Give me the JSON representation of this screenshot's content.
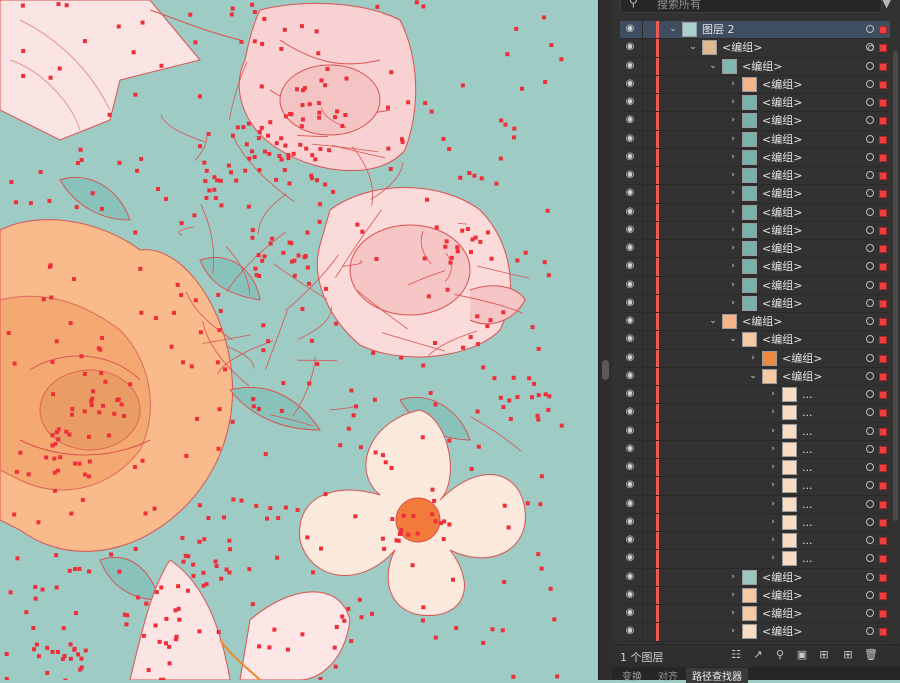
{
  "search": {
    "placeholder": "搜索所有"
  },
  "layers": [
    {
      "label": "图层 2",
      "depth": 0,
      "caret": "open",
      "thumb": "#a8d2cc",
      "selected": true,
      "target": "single"
    },
    {
      "label": "<编组>",
      "depth": 1,
      "caret": "open",
      "thumb": "#e0b890",
      "target": "double"
    },
    {
      "label": "<编组>",
      "depth": 2,
      "caret": "open",
      "thumb": "#7fb8b2",
      "target": "single"
    },
    {
      "label": "<编组>",
      "depth": 3,
      "caret": "closed",
      "thumb": "#f3b48a",
      "target": "single"
    },
    {
      "label": "<编组>",
      "depth": 3,
      "caret": "closed",
      "thumb": "#78b2ac",
      "target": "single"
    },
    {
      "label": "<编组>",
      "depth": 3,
      "caret": "closed",
      "thumb": "#78b2ac",
      "target": "single"
    },
    {
      "label": "<编组>",
      "depth": 3,
      "caret": "closed",
      "thumb": "#78b2ac",
      "target": "single"
    },
    {
      "label": "<编组>",
      "depth": 3,
      "caret": "closed",
      "thumb": "#78b2ac",
      "target": "single"
    },
    {
      "label": "<编组>",
      "depth": 3,
      "caret": "closed",
      "thumb": "#78b2ac",
      "target": "single"
    },
    {
      "label": "<编组>",
      "depth": 3,
      "caret": "closed",
      "thumb": "#78b2ac",
      "target": "single"
    },
    {
      "label": "<编组>",
      "depth": 3,
      "caret": "closed",
      "thumb": "#78b2ac",
      "target": "single"
    },
    {
      "label": "<编组>",
      "depth": 3,
      "caret": "closed",
      "thumb": "#78b2ac",
      "target": "single"
    },
    {
      "label": "<编组>",
      "depth": 3,
      "caret": "closed",
      "thumb": "#78b2ac",
      "target": "single"
    },
    {
      "label": "<编组>",
      "depth": 3,
      "caret": "closed",
      "thumb": "#78b2ac",
      "target": "single"
    },
    {
      "label": "<编组>",
      "depth": 3,
      "caret": "closed",
      "thumb": "#78b2ac",
      "target": "single"
    },
    {
      "label": "<编组>",
      "depth": 3,
      "caret": "closed",
      "thumb": "#78b2ac",
      "target": "single"
    },
    {
      "label": "<编组>",
      "depth": 2,
      "caret": "open",
      "thumb": "#f3b48a",
      "target": "single"
    },
    {
      "label": "<编组>",
      "depth": 3,
      "caret": "open",
      "thumb": "#f6c9a3",
      "target": "single"
    },
    {
      "label": "<编组>",
      "depth": 4,
      "caret": "closed",
      "thumb": "#ee8a3e",
      "target": "single"
    },
    {
      "label": "<编组>",
      "depth": 4,
      "caret": "open",
      "thumb": "#f6c9a3",
      "target": "single"
    },
    {
      "label": "...",
      "depth": 5,
      "caret": "closed",
      "thumb": "#f8dcc4",
      "target": "single"
    },
    {
      "label": "...",
      "depth": 5,
      "caret": "closed",
      "thumb": "#f8dcc4",
      "target": "single"
    },
    {
      "label": "...",
      "depth": 5,
      "caret": "closed",
      "thumb": "#f8dcc4",
      "target": "single"
    },
    {
      "label": "...",
      "depth": 5,
      "caret": "closed",
      "thumb": "#f8dcc4",
      "target": "single"
    },
    {
      "label": "...",
      "depth": 5,
      "caret": "closed",
      "thumb": "#f8dcc4",
      "target": "single"
    },
    {
      "label": "...",
      "depth": 5,
      "caret": "closed",
      "thumb": "#f8dcc4",
      "target": "single"
    },
    {
      "label": "...",
      "depth": 5,
      "caret": "closed",
      "thumb": "#f8dcc4",
      "target": "single"
    },
    {
      "label": "...",
      "depth": 5,
      "caret": "closed",
      "thumb": "#f8dcc4",
      "target": "single"
    },
    {
      "label": "...",
      "depth": 5,
      "caret": "closed",
      "thumb": "#f8dcc4",
      "target": "single"
    },
    {
      "label": "...",
      "depth": 5,
      "caret": "closed",
      "thumb": "#f8dcc4",
      "target": "single"
    },
    {
      "label": "<编组>",
      "depth": 3,
      "caret": "closed",
      "thumb": "#9cc6c0",
      "target": "single"
    },
    {
      "label": "<编组>",
      "depth": 3,
      "caret": "closed",
      "thumb": "#f6c9a3",
      "target": "single"
    },
    {
      "label": "<编组>",
      "depth": 3,
      "caret": "closed",
      "thumb": "#f6c9a3",
      "target": "single"
    },
    {
      "label": "<编组>",
      "depth": 3,
      "caret": "closed",
      "thumb": "#f8dcc4",
      "target": "single"
    }
  ],
  "footer": {
    "layer_count": "1 个图层"
  },
  "tabs": [
    "变换",
    "对齐",
    "路径查找器"
  ],
  "colors": {
    "canvas_bg": "#9fcbc5",
    "anchor": "#ee2f3a",
    "path": "#d9534f",
    "panel_bg": "#323232",
    "selection": "#3e4d5f",
    "layer_color": "#ee5a4f"
  }
}
